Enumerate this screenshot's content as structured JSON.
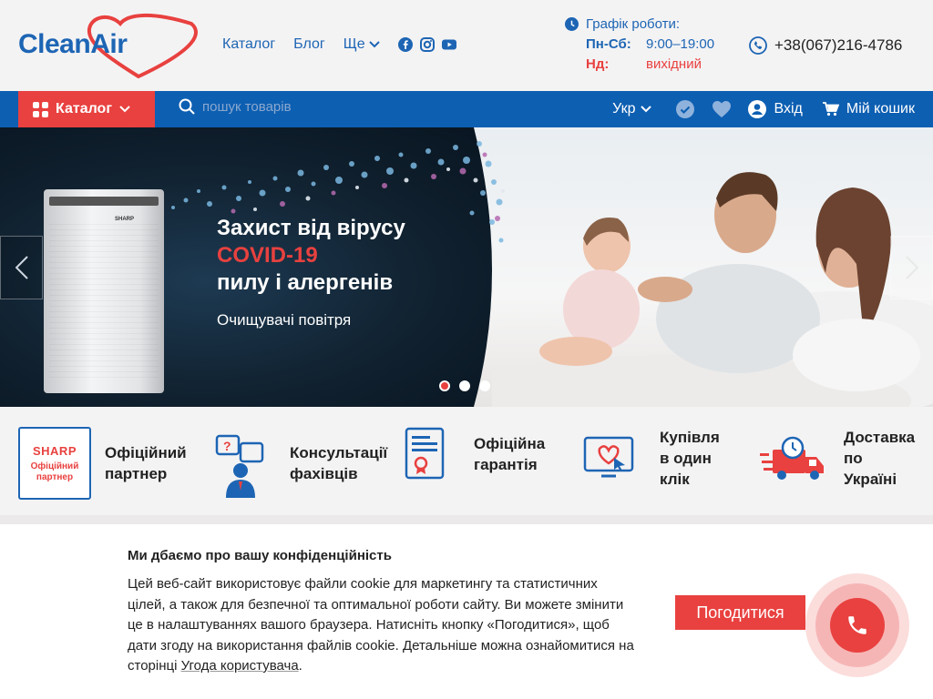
{
  "brand": {
    "name": "CleanAir",
    "color": "#1d65b4",
    "accent": "#e8413f"
  },
  "nav": {
    "catalog": "Каталог",
    "blog": "Блог",
    "more": "Ще"
  },
  "socials": [
    "facebook-icon",
    "instagram-icon",
    "youtube-icon"
  ],
  "schedule": {
    "title": "Графік роботи:",
    "rows": [
      {
        "day": "Пн-Сб:",
        "time": "9:00–19:00"
      },
      {
        "day": "Нд:",
        "time": "вихідний"
      }
    ]
  },
  "phone": "+38(067)216-4786",
  "bar": {
    "catalog_label": "Каталог",
    "search_placeholder": "пошук товарів",
    "lang": "Укр",
    "login": "Вхід",
    "cart": "Мій кошик"
  },
  "hero": {
    "line1": "Захист від вірусу",
    "line2": "COVID-19",
    "line3": "пилу і алергенів",
    "line4": "Очищувачі повітря",
    "product_brand": "SHARP",
    "slides": 3,
    "active_slide": 1
  },
  "features": [
    {
      "badge_brand": "SHARP",
      "badge_text": "Офіційний партнер",
      "line1": "Офіційний",
      "line2": "партнер"
    },
    {
      "line1": "Консультації",
      "line2": "фахівців"
    },
    {
      "line1": "Офіційна",
      "line2": "гарантія"
    },
    {
      "line1": "Купівля",
      "line2": "в один",
      "line3": "клік"
    },
    {
      "line1": "Доставка",
      "line2": "по",
      "line3": "Україні"
    }
  ],
  "cookie": {
    "title": "Ми дбаємо про вашу конфіденційність",
    "text": "Цей веб-сайт використовує файли cookie для маркетингу та статистичних цілей, а також для безпечної та оптимальної роботи сайту. Ви можете змінити це в налаштуваннях вашого браузера. Натисніть кнопку «Погодитися», щоб дати згоду на використання файлів cookie. Детальніше можна ознайомитися на сторінці ",
    "link": "Угода користувача",
    "after_link": ".",
    "agree": "Погодитися"
  }
}
